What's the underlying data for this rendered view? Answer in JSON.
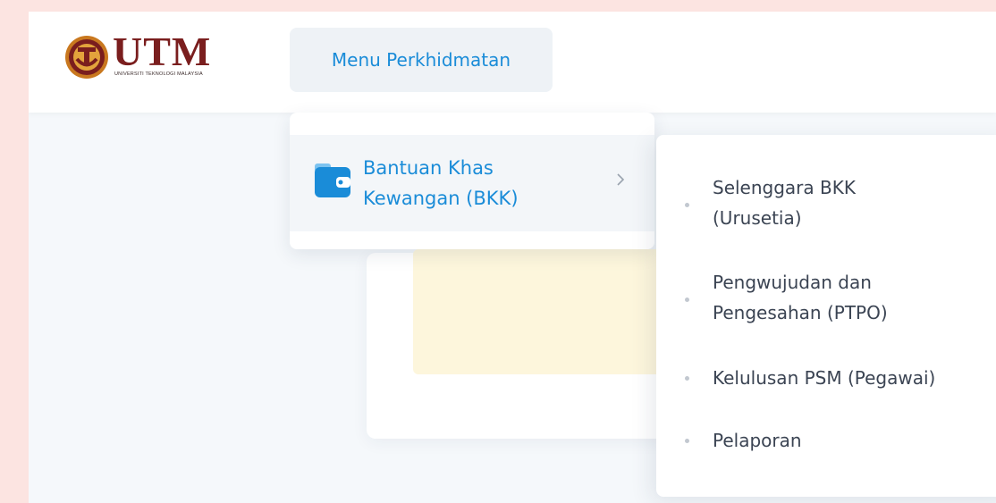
{
  "colors": {
    "outer_background": "#fce4e1",
    "app_background": "#f5f8fb",
    "accent_blue": "#1a8cd8",
    "brand_maroon": "#7a1e1e",
    "submenu_text": "#3b4453",
    "yellow_panel": "#fdf6dc"
  },
  "logo": {
    "text": "UTM",
    "subtext": "UNIVERSITI TEKNOLOGI MALAYSIA",
    "icon": "utm-seal-icon"
  },
  "header": {
    "menu_label": "Menu Perkhidmatan"
  },
  "dropdown": {
    "items": [
      {
        "label_line1": "Bantuan Khas",
        "label_line2": "Kewangan (BKK)",
        "icon": "wallet-icon",
        "chevron": "chevron-right-icon"
      }
    ]
  },
  "submenu": {
    "items": [
      {
        "line1": "Selenggara BKK",
        "line2": "(Urusetia)"
      },
      {
        "line1": "Pengwujudan dan",
        "line2": "Pengesahan (PTPO)"
      },
      {
        "line1": "Kelulusan PSM (Pegawai)"
      },
      {
        "line1": "Pelaporan"
      }
    ]
  }
}
